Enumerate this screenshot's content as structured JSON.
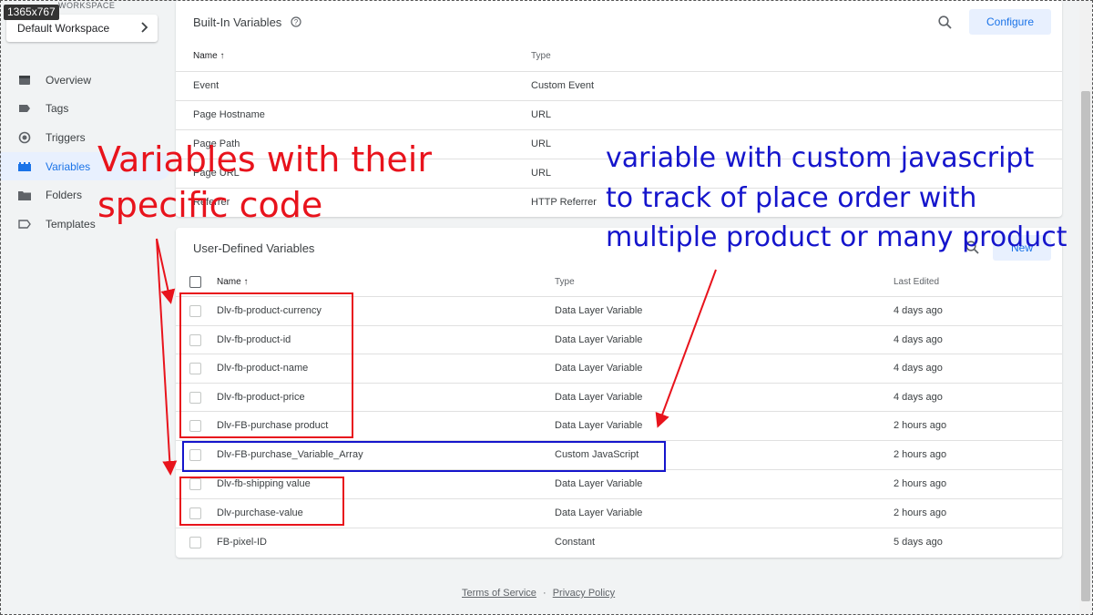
{
  "screenshot_badge": "1365x767",
  "workspace": {
    "label": "WORKSPACE",
    "current": "Default Workspace"
  },
  "sidebar": {
    "items": [
      {
        "label": "Overview",
        "icon": "overview-icon"
      },
      {
        "label": "Tags",
        "icon": "tag-icon"
      },
      {
        "label": "Triggers",
        "icon": "trigger-icon"
      },
      {
        "label": "Variables",
        "icon": "variables-icon",
        "active": true
      },
      {
        "label": "Folders",
        "icon": "folder-icon"
      },
      {
        "label": "Templates",
        "icon": "template-icon"
      }
    ]
  },
  "builtin": {
    "title": "Built-In Variables",
    "configure_label": "Configure",
    "columns": [
      "Name",
      "Type"
    ],
    "rows": [
      {
        "name": "Event",
        "type": "Custom Event"
      },
      {
        "name": "Page Hostname",
        "type": "URL"
      },
      {
        "name": "Page Path",
        "type": "URL"
      },
      {
        "name": "Page URL",
        "type": "URL"
      },
      {
        "name": "Referrer",
        "type": "HTTP Referrer"
      }
    ]
  },
  "userdefined": {
    "title": "User-Defined Variables",
    "new_label": "New",
    "columns": [
      "Name",
      "Type",
      "Last Edited"
    ],
    "rows": [
      {
        "name": "Dlv-fb-product-currency",
        "type": "Data Layer Variable",
        "edited": "4 days ago"
      },
      {
        "name": "Dlv-fb-product-id",
        "type": "Data Layer Variable",
        "edited": "4 days ago"
      },
      {
        "name": "Dlv-fb-product-name",
        "type": "Data Layer Variable",
        "edited": "4 days ago"
      },
      {
        "name": "Dlv-fb-product-price",
        "type": "Data Layer Variable",
        "edited": "4 days ago"
      },
      {
        "name": "Dlv-FB-purchase product",
        "type": "Data Layer Variable",
        "edited": "2 hours ago"
      },
      {
        "name": "Dlv-FB-purchase_Variable_Array",
        "type": "Custom JavaScript",
        "edited": "2 hours ago"
      },
      {
        "name": "Dlv-fb-shipping value",
        "type": "Data Layer Variable",
        "edited": "2 hours ago"
      },
      {
        "name": "Dlv-purchase-value",
        "type": "Data Layer Variable",
        "edited": "2 hours ago"
      },
      {
        "name": "FB-pixel-ID",
        "type": "Constant",
        "edited": "5 days ago"
      }
    ]
  },
  "footer": {
    "terms": "Terms of Service",
    "sep": "·",
    "privacy": "Privacy Policy"
  },
  "annotations": {
    "red_line1": "Variables with their",
    "red_line2": "specific code",
    "blue_line1": "variable with custom javascript",
    "blue_line2": "to track of place order with",
    "blue_line3": "multiple product or many product"
  },
  "colors": {
    "accent": "#1a73e8",
    "annotation_red": "#e8131c",
    "annotation_blue": "#1515cc"
  }
}
